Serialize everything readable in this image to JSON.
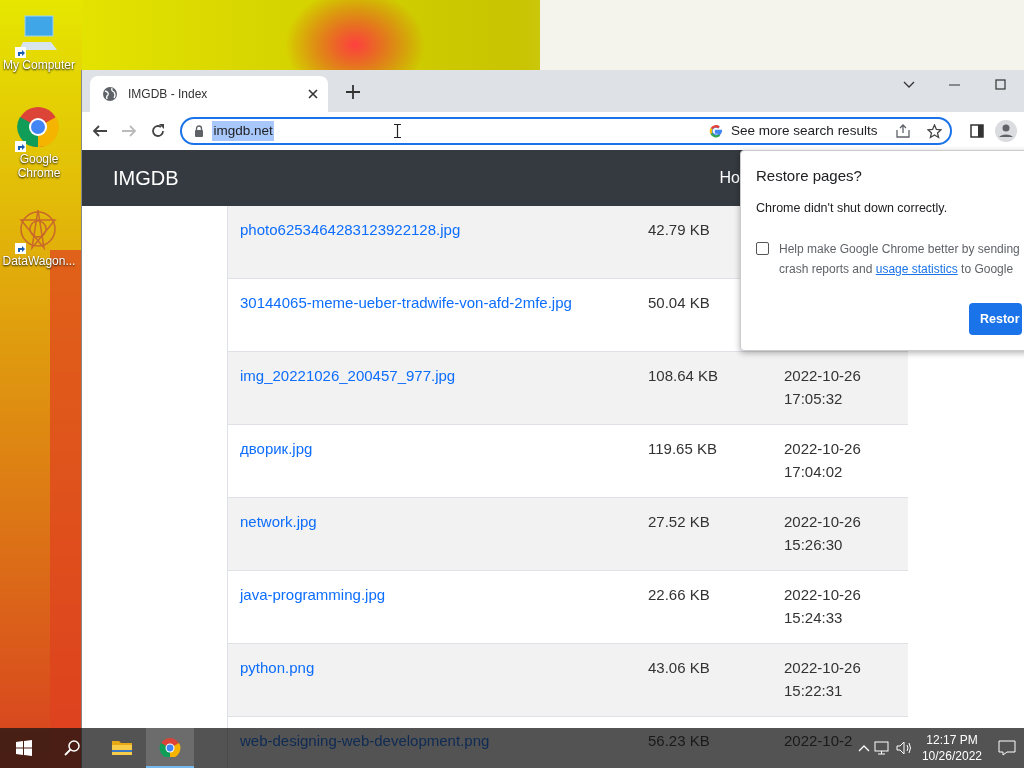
{
  "desktop_icons": [
    {
      "kind": "computer",
      "label": "My Computer"
    },
    {
      "kind": "chrome",
      "label": "Google Chrome"
    },
    {
      "kind": "star",
      "label": "DataWagon..."
    }
  ],
  "browser": {
    "tabs": [
      {
        "title": "IMGDB - Index",
        "selected": true
      }
    ],
    "nav_buttons": [
      {
        "kind": "back",
        "disabled": false
      },
      {
        "kind": "forward",
        "disabled": true
      },
      {
        "kind": "reload",
        "disabled": false
      }
    ],
    "address": {
      "value": "imgdb.net",
      "selected": true
    },
    "suggestion": "See more search results"
  },
  "site": {
    "brand": "IMGDB",
    "nav_link": "Ho",
    "rows": [
      {
        "name": "photo6253464283123922128.jpg",
        "size": "42.79 KB"
      },
      {
        "name": "30144065-meme-ueber-tradwife-von-afd-2mfe.jpg",
        "size": "50.04 KB"
      },
      {
        "name": "img_20221026_200457_977.jpg",
        "size": "108.64 KB",
        "date": "2022-10-26",
        "time": "17:05:32"
      },
      {
        "name": "дворик.jpg",
        "size": "119.65 KB",
        "date": "2022-10-26",
        "time": "17:04:02"
      },
      {
        "name": "network.jpg",
        "size": "27.52 KB",
        "date": "2022-10-26",
        "time": "15:26:30"
      },
      {
        "name": "java-programming.jpg",
        "size": "22.66 KB",
        "date": "2022-10-26",
        "time": "15:24:33"
      },
      {
        "name": "python.png",
        "size": "43.06 KB",
        "date": "2022-10-26",
        "time": "15:22:31"
      },
      {
        "name": "web-designing-web-development.png",
        "size": "56.23 KB",
        "date": "2022-10-2"
      }
    ]
  },
  "restore_popup": {
    "title": "Restore pages?",
    "message": "Chrome didn't shut down correctly.",
    "checkbox": {
      "checked": false,
      "text_before": "Help make Google Chrome better by sending crash reports and",
      "link": "usage statistics",
      "text_after": "to Google"
    },
    "button": "Restor"
  },
  "taskbar": {
    "apps": [
      {
        "kind": "explorer",
        "active": false
      },
      {
        "kind": "chrome",
        "active": true
      }
    ],
    "time": "12:17 PM",
    "date": "10/26/2022"
  }
}
